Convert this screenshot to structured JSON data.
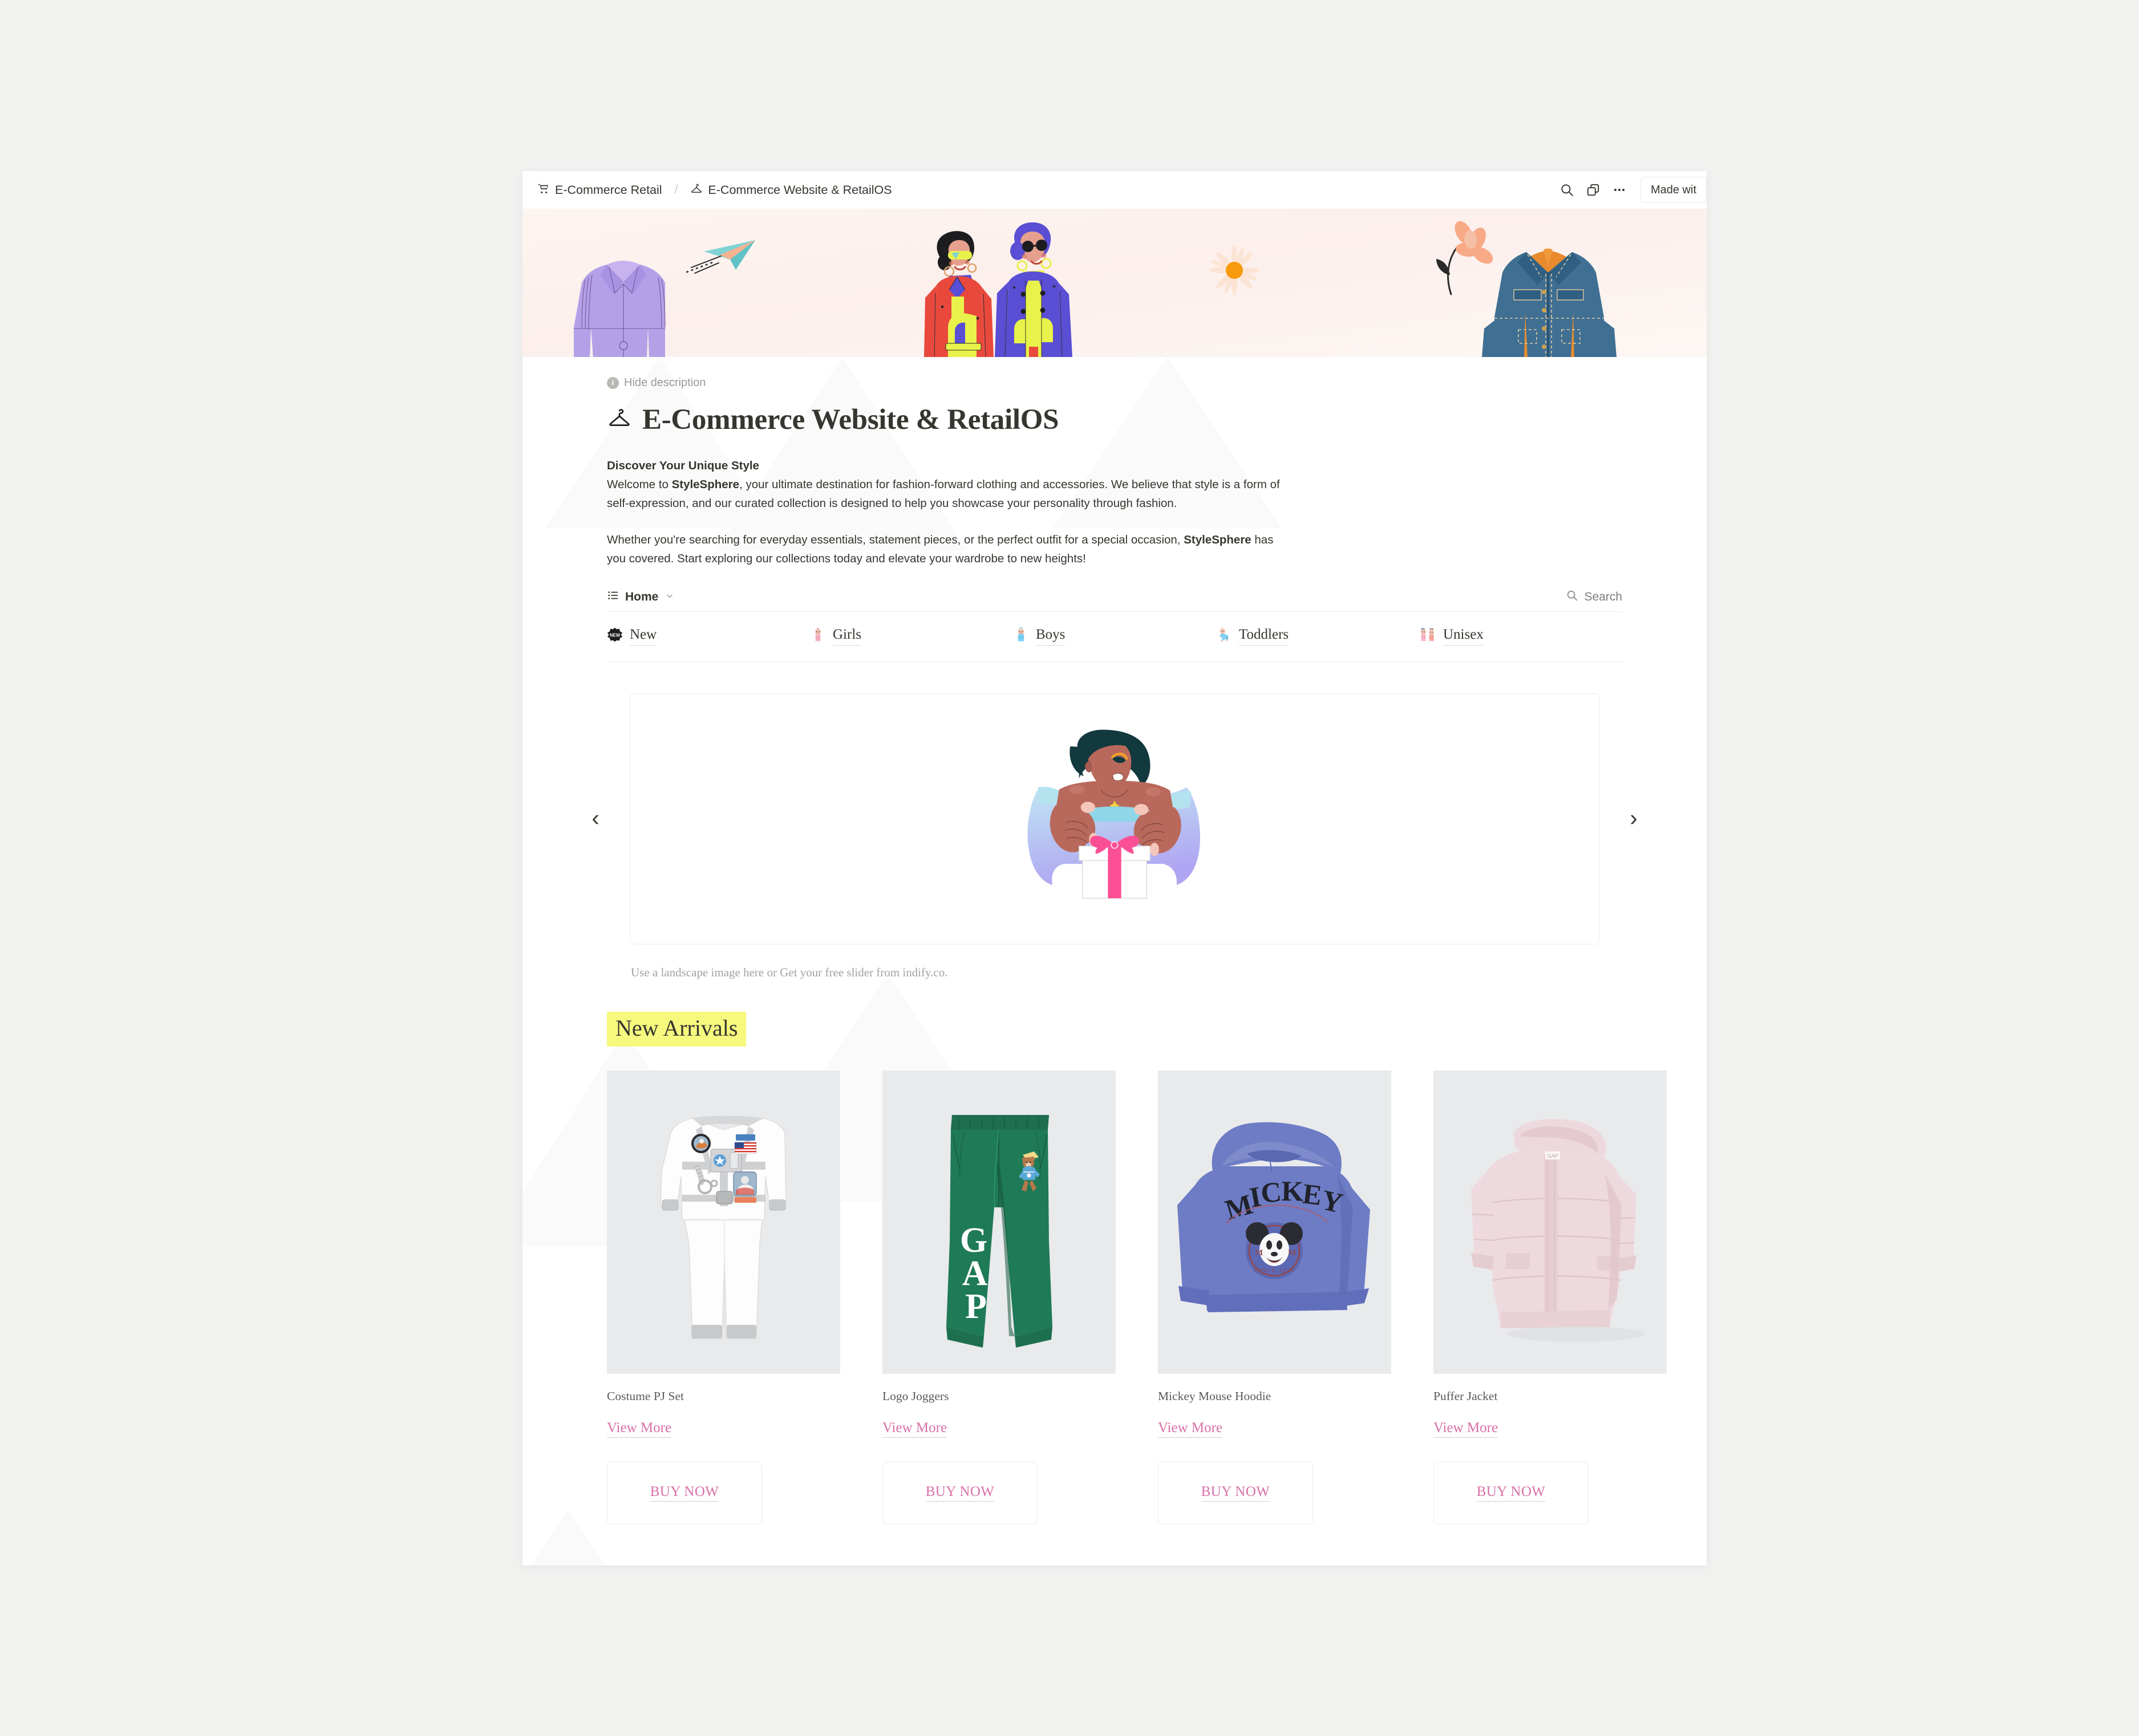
{
  "topbar": {
    "breadcrumb": [
      {
        "icon": "shopping-cart-icon",
        "glyph": "🛒",
        "label": "E-Commerce Retail"
      },
      {
        "icon": "clothes-hanger-icon",
        "glyph": "⛏",
        "label": "E-Commerce Website & RetailOS"
      }
    ],
    "separator": "/",
    "actions": [
      {
        "name": "search-icon",
        "label": "Search"
      },
      {
        "name": "duplicate-icon",
        "label": "Duplicate"
      },
      {
        "name": "more-options-icon",
        "label": "•••"
      }
    ],
    "made_with_label": "Made wit"
  },
  "page": {
    "hide_description_label": "Hide description",
    "title": "E-Commerce Website & RetailOS",
    "title_icon": "clothes-hanger-icon",
    "description": {
      "heading": "Discover Your Unique Style",
      "para1_pre": "Welcome to ",
      "para1_brand": "StyleSphere",
      "para1_post": ", your ultimate destination for fashion-forward clothing and accessories. We believe that style is a form of self-expression, and our curated collection is designed to help you showcase your personality through fashion.",
      "para2_pre": "Whether you're searching for everyday essentials, statement pieces, or the perfect outfit for a special occasion, ",
      "para2_brand": "StyleSphere",
      "para2_post": " has you covered. Start exploring our collections today and elevate your wardrobe to new heights!"
    }
  },
  "view_bar": {
    "view_name": "Home",
    "view_icon": "list-view-icon",
    "chevron": "⌄",
    "search_label": "Search"
  },
  "categories": [
    {
      "emoji": "🆕",
      "label": "New"
    },
    {
      "emoji": "👶",
      "label": "Girls"
    },
    {
      "emoji": "👶",
      "label": "Boys"
    },
    {
      "emoji": "👶",
      "label": "Toddlers"
    },
    {
      "emoji": "👫",
      "label": "Unisex"
    }
  ],
  "carousel": {
    "prev_glyph": "‹",
    "next_glyph": "›",
    "illustration": "woman-holding-gift-box-illustration",
    "caption": "Use a landscape image here or Get your free slider from indify.co."
  },
  "new_arrivals": {
    "heading": "New Arrivals",
    "highlight_color": "#f6f97e",
    "link_color": "#d96fa8",
    "products": [
      {
        "title": "Costume PJ Set",
        "view_more": "View More",
        "buy_now": "BUY NOW",
        "image": "astronaut-costume-pajama-set"
      },
      {
        "title": "Logo Joggers",
        "view_more": "View More",
        "buy_now": "BUY NOW",
        "image": "green-gap-logo-joggers"
      },
      {
        "title": "Mickey Mouse Hoodie",
        "view_more": "View More",
        "buy_now": "BUY NOW",
        "image": "blue-mickey-mouse-hoodie"
      },
      {
        "title": "Puffer Jacket",
        "view_more": "View More",
        "buy_now": "BUY NOW",
        "image": "pink-puffer-jacket"
      }
    ]
  }
}
